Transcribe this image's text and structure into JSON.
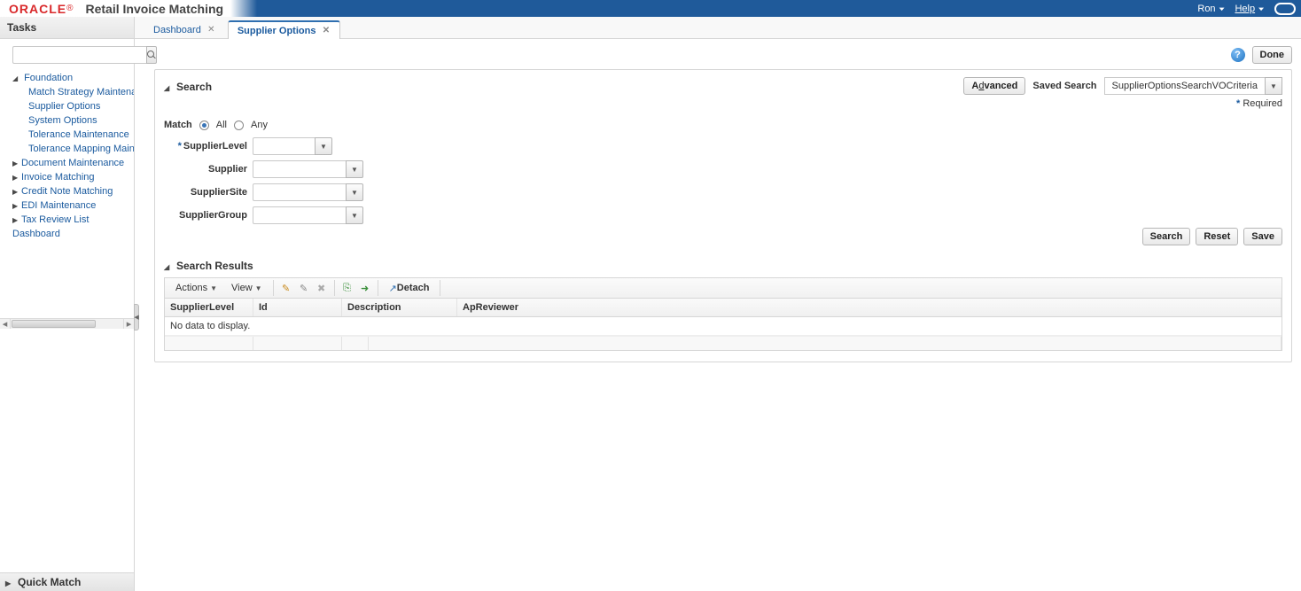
{
  "brand": {
    "logo": "ORACLE",
    "sup": "®",
    "app": "Retail Invoice Matching"
  },
  "banner": {
    "user": "Ron",
    "help": "Help"
  },
  "sidebar": {
    "title": "Tasks",
    "search_placeholder": "",
    "groups": {
      "foundation": {
        "label": "Foundation",
        "expanded": true,
        "items": [
          "Match Strategy Maintenance",
          "Supplier Options",
          "System Options",
          "Tolerance Maintenance",
          "Tolerance Mapping Maintenance"
        ]
      },
      "others": [
        "Document Maintenance",
        "Invoice Matching",
        "Credit Note Matching",
        "EDI Maintenance",
        "Tax Review List"
      ],
      "dashboard": "Dashboard"
    },
    "quick_match": "Quick Match"
  },
  "tabs": [
    {
      "label": "Dashboard",
      "active": false
    },
    {
      "label": "Supplier Options",
      "active": true
    }
  ],
  "top": {
    "done": "Done"
  },
  "search": {
    "title": "Search",
    "advanced": "Advanced",
    "saved_label": "Saved Search",
    "saved_value": "SupplierOptionsSearchVOCriteria",
    "required": "Required",
    "match": {
      "label": "Match",
      "all": "All",
      "any": "Any",
      "selected": "all"
    },
    "fields": {
      "supplier_level": {
        "label": "SupplierLevel",
        "required": true,
        "value": ""
      },
      "supplier": {
        "label": "Supplier",
        "required": false,
        "value": ""
      },
      "supplier_site": {
        "label": "SupplierSite",
        "required": false,
        "value": ""
      },
      "supplier_group": {
        "label": "SupplierGroup",
        "required": false,
        "value": ""
      }
    },
    "buttons": {
      "search": "Search",
      "reset": "Reset",
      "save": "Save"
    }
  },
  "results": {
    "title": "Search Results",
    "toolbar": {
      "actions": "Actions",
      "view": "View",
      "detach": "Detach"
    },
    "columns": [
      "SupplierLevel",
      "Id",
      "Description",
      "ApReviewer"
    ],
    "empty": "No data to display.",
    "rows": []
  }
}
